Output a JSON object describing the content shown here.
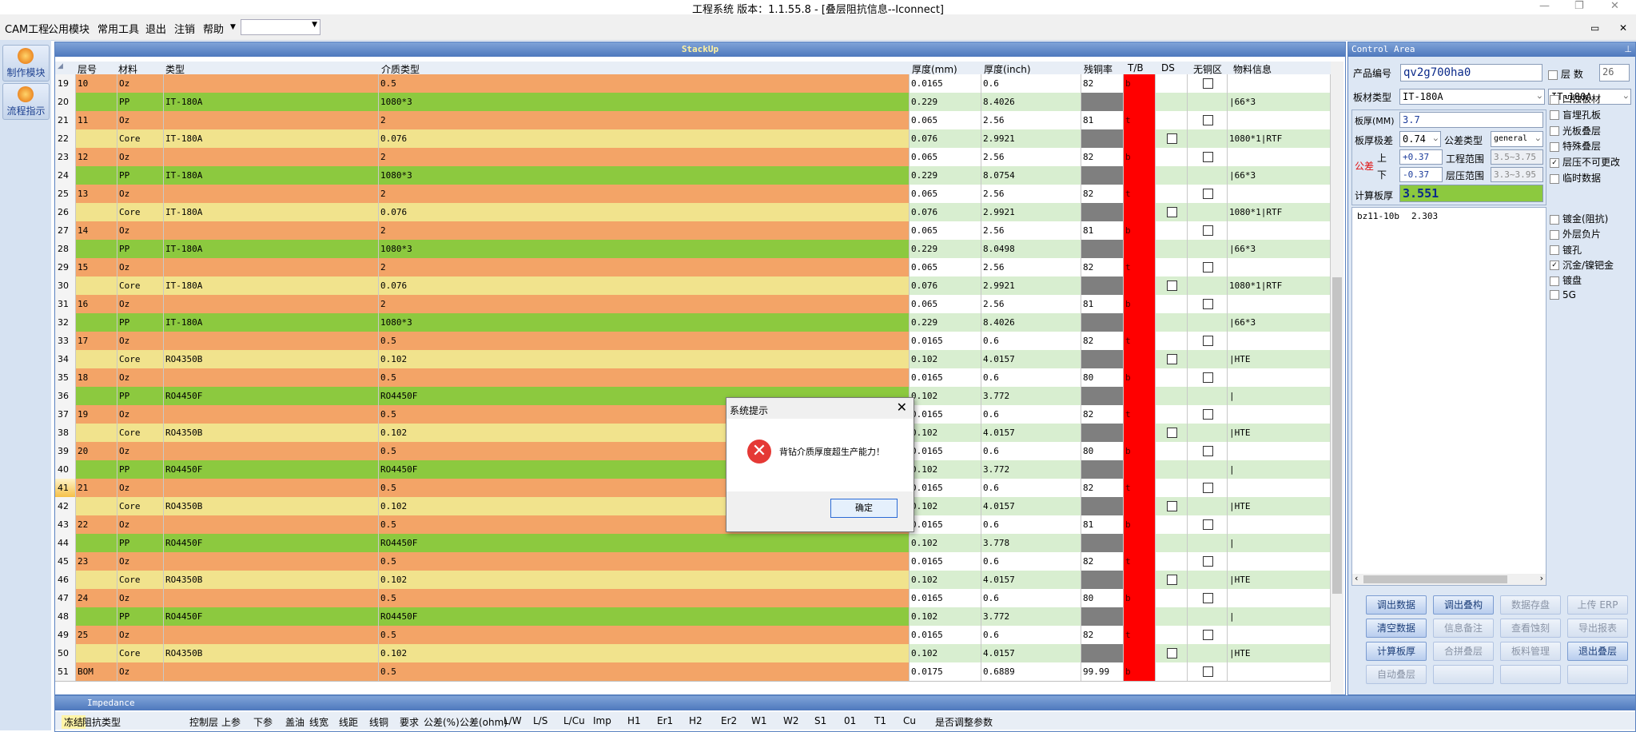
{
  "window": {
    "title": "工程系统   版本：1.1.55.8 - [叠层阻抗信息--Iconnect]"
  },
  "menu": {
    "items": [
      "CAM工程",
      "公用模块",
      "常用工具",
      "退出",
      "注销",
      "帮助"
    ]
  },
  "left_nav": [
    {
      "label": "制作模块",
      "icon": "flame-icon"
    },
    {
      "label": "流程指示",
      "icon": "pause-icon"
    }
  ],
  "stackup": {
    "title": "StackUp",
    "columns": [
      "层号",
      "材料",
      "类型",
      "介质类型",
      "厚度(mm)",
      "厚度(inch)",
      "残铜率",
      "T/B",
      "DS",
      "无铜区",
      "物料信息"
    ],
    "rows": [
      {
        "n": "19",
        "layer": "10",
        "mat": "Oz",
        "type": "",
        "med": "0.5",
        "mm": "0.0165",
        "inch": "0.6",
        "cu": "82",
        "tb": "b",
        "ds": false,
        "nocu": true,
        "info": ""
      },
      {
        "n": "20",
        "layer": "",
        "mat": "PP",
        "type": "IT-180A",
        "med": "1080*3",
        "mm": "0.229",
        "inch": "8.4026",
        "cu": "",
        "tb": "",
        "ds": false,
        "nocu": false,
        "info": "|66*3"
      },
      {
        "n": "21",
        "layer": "11",
        "mat": "Oz",
        "type": "",
        "med": "2",
        "mm": "0.065",
        "inch": "2.56",
        "cu": "81",
        "tb": "t",
        "ds": false,
        "nocu": true,
        "info": ""
      },
      {
        "n": "22",
        "layer": "",
        "mat": "Core",
        "type": "IT-180A",
        "med": "0.076",
        "mm": "0.076",
        "inch": "2.9921",
        "cu": "",
        "tb": "",
        "ds": true,
        "nocu": false,
        "info": "1080*1|RTF"
      },
      {
        "n": "23",
        "layer": "12",
        "mat": "Oz",
        "type": "",
        "med": "2",
        "mm": "0.065",
        "inch": "2.56",
        "cu": "82",
        "tb": "b",
        "ds": false,
        "nocu": true,
        "info": ""
      },
      {
        "n": "24",
        "layer": "",
        "mat": "PP",
        "type": "IT-180A",
        "med": "1080*3",
        "mm": "0.229",
        "inch": "8.0754",
        "cu": "",
        "tb": "",
        "ds": false,
        "nocu": false,
        "info": "|66*3"
      },
      {
        "n": "25",
        "layer": "13",
        "mat": "Oz",
        "type": "",
        "med": "2",
        "mm": "0.065",
        "inch": "2.56",
        "cu": "82",
        "tb": "t",
        "ds": false,
        "nocu": true,
        "info": ""
      },
      {
        "n": "26",
        "layer": "",
        "mat": "Core",
        "type": "IT-180A",
        "med": "0.076",
        "mm": "0.076",
        "inch": "2.9921",
        "cu": "",
        "tb": "",
        "ds": true,
        "nocu": false,
        "info": "1080*1|RTF"
      },
      {
        "n": "27",
        "layer": "14",
        "mat": "Oz",
        "type": "",
        "med": "2",
        "mm": "0.065",
        "inch": "2.56",
        "cu": "81",
        "tb": "b",
        "ds": false,
        "nocu": true,
        "info": ""
      },
      {
        "n": "28",
        "layer": "",
        "mat": "PP",
        "type": "IT-180A",
        "med": "1080*3",
        "mm": "0.229",
        "inch": "8.0498",
        "cu": "",
        "tb": "",
        "ds": false,
        "nocu": false,
        "info": "|66*3"
      },
      {
        "n": "29",
        "layer": "15",
        "mat": "Oz",
        "type": "",
        "med": "2",
        "mm": "0.065",
        "inch": "2.56",
        "cu": "82",
        "tb": "t",
        "ds": false,
        "nocu": true,
        "info": ""
      },
      {
        "n": "30",
        "layer": "",
        "mat": "Core",
        "type": "IT-180A",
        "med": "0.076",
        "mm": "0.076",
        "inch": "2.9921",
        "cu": "",
        "tb": "",
        "ds": true,
        "nocu": false,
        "info": "1080*1|RTF"
      },
      {
        "n": "31",
        "layer": "16",
        "mat": "Oz",
        "type": "",
        "med": "2",
        "mm": "0.065",
        "inch": "2.56",
        "cu": "81",
        "tb": "b",
        "ds": false,
        "nocu": true,
        "info": ""
      },
      {
        "n": "32",
        "layer": "",
        "mat": "PP",
        "type": "IT-180A",
        "med": "1080*3",
        "mm": "0.229",
        "inch": "8.4026",
        "cu": "",
        "tb": "",
        "ds": false,
        "nocu": false,
        "info": "|66*3"
      },
      {
        "n": "33",
        "layer": "17",
        "mat": "Oz",
        "type": "",
        "med": "0.5",
        "mm": "0.0165",
        "inch": "0.6",
        "cu": "82",
        "tb": "t",
        "ds": false,
        "nocu": true,
        "info": ""
      },
      {
        "n": "34",
        "layer": "",
        "mat": "Core",
        "type": "RO4350B",
        "med": "0.102",
        "mm": "0.102",
        "inch": "4.0157",
        "cu": "",
        "tb": "",
        "ds": true,
        "nocu": false,
        "info": "|HTE"
      },
      {
        "n": "35",
        "layer": "18",
        "mat": "Oz",
        "type": "",
        "med": "0.5",
        "mm": "0.0165",
        "inch": "0.6",
        "cu": "80",
        "tb": "b",
        "ds": false,
        "nocu": true,
        "info": ""
      },
      {
        "n": "36",
        "layer": "",
        "mat": "PP",
        "type": "RO4450F",
        "med": "RO4450F",
        "mm": "0.102",
        "inch": "3.772",
        "cu": "",
        "tb": "",
        "ds": false,
        "nocu": false,
        "info": "|"
      },
      {
        "n": "37",
        "layer": "19",
        "mat": "Oz",
        "type": "",
        "med": "0.5",
        "mm": "0.0165",
        "inch": "0.6",
        "cu": "82",
        "tb": "t",
        "ds": false,
        "nocu": true,
        "info": ""
      },
      {
        "n": "38",
        "layer": "",
        "mat": "Core",
        "type": "RO4350B",
        "med": "0.102",
        "mm": "0.102",
        "inch": "4.0157",
        "cu": "",
        "tb": "",
        "ds": true,
        "nocu": false,
        "info": "|HTE"
      },
      {
        "n": "39",
        "layer": "20",
        "mat": "Oz",
        "type": "",
        "med": "0.5",
        "mm": "0.0165",
        "inch": "0.6",
        "cu": "80",
        "tb": "b",
        "ds": false,
        "nocu": true,
        "info": ""
      },
      {
        "n": "40",
        "layer": "",
        "mat": "PP",
        "type": "RO4450F",
        "med": "RO4450F",
        "mm": "0.102",
        "inch": "3.772",
        "cu": "",
        "tb": "",
        "ds": false,
        "nocu": false,
        "info": "|"
      },
      {
        "n": "41",
        "layer": "21",
        "mat": "Oz",
        "type": "",
        "med": "0.5",
        "mm": "0.0165",
        "inch": "0.6",
        "cu": "82",
        "tb": "t",
        "ds": false,
        "nocu": true,
        "info": ""
      },
      {
        "n": "42",
        "layer": "",
        "mat": "Core",
        "type": "RO4350B",
        "med": "0.102",
        "mm": "0.102",
        "inch": "4.0157",
        "cu": "",
        "tb": "",
        "ds": true,
        "nocu": false,
        "info": "|HTE"
      },
      {
        "n": "43",
        "layer": "22",
        "mat": "Oz",
        "type": "",
        "med": "0.5",
        "mm": "0.0165",
        "inch": "0.6",
        "cu": "81",
        "tb": "b",
        "ds": false,
        "nocu": true,
        "info": ""
      },
      {
        "n": "44",
        "layer": "",
        "mat": "PP",
        "type": "RO4450F",
        "med": "RO4450F",
        "mm": "0.102",
        "inch": "3.778",
        "cu": "",
        "tb": "",
        "ds": false,
        "nocu": false,
        "info": "|"
      },
      {
        "n": "45",
        "layer": "23",
        "mat": "Oz",
        "type": "",
        "med": "0.5",
        "mm": "0.0165",
        "inch": "0.6",
        "cu": "82",
        "tb": "t",
        "ds": false,
        "nocu": true,
        "info": ""
      },
      {
        "n": "46",
        "layer": "",
        "mat": "Core",
        "type": "RO4350B",
        "med": "0.102",
        "mm": "0.102",
        "inch": "4.0157",
        "cu": "",
        "tb": "",
        "ds": true,
        "nocu": false,
        "info": "|HTE"
      },
      {
        "n": "47",
        "layer": "24",
        "mat": "Oz",
        "type": "",
        "med": "0.5",
        "mm": "0.0165",
        "inch": "0.6",
        "cu": "80",
        "tb": "b",
        "ds": false,
        "nocu": true,
        "info": ""
      },
      {
        "n": "48",
        "layer": "",
        "mat": "PP",
        "type": "RO4450F",
        "med": "RO4450F",
        "mm": "0.102",
        "inch": "3.772",
        "cu": "",
        "tb": "",
        "ds": false,
        "nocu": false,
        "info": "|"
      },
      {
        "n": "49",
        "layer": "25",
        "mat": "Oz",
        "type": "",
        "med": "0.5",
        "mm": "0.0165",
        "inch": "0.6",
        "cu": "82",
        "tb": "t",
        "ds": false,
        "nocu": true,
        "info": ""
      },
      {
        "n": "50",
        "layer": "",
        "mat": "Core",
        "type": "RO4350B",
        "med": "0.102",
        "mm": "0.102",
        "inch": "4.0157",
        "cu": "",
        "tb": "",
        "ds": true,
        "nocu": false,
        "info": "|HTE"
      },
      {
        "n": "51",
        "layer": "BOM",
        "mat": "Oz",
        "type": "",
        "med": "0.5",
        "mm": "0.0175",
        "inch": "0.6889",
        "cu": "99.99",
        "tb": "b",
        "ds": false,
        "nocu": true,
        "info": ""
      }
    ]
  },
  "control": {
    "title": "Control Area",
    "product_label": "产品编号",
    "product_value": "qv2g700ha0",
    "layers_label": "层  数",
    "layers_value": "26",
    "board_type_label": "板材类型",
    "board_type_value": "IT-180A",
    "board_type_value2": "IT-180A",
    "thickness_label": "板厚(MM)",
    "thickness_value": "3.7",
    "tol_level_label": "板厚极差",
    "tol_level_value": "0.74",
    "tol_type_label": "公差类型",
    "tol_type_value": "general",
    "tol_label": "公差",
    "upper_label": "上",
    "lower_label": "下",
    "upper_value": "+0.37",
    "lower_value": "-0.37",
    "eng_range_label": "工程范围",
    "eng_range_value": "3.5~3.75",
    "press_range_label": "层压范围",
    "press_range_value": "3.3~3.95",
    "calc_label": "计算板厚",
    "calc_value": "3.551",
    "list_item": {
      "name": "bz11-10b",
      "value": "2.303"
    },
    "checks": [
      {
        "label": "凹蚀板材",
        "checked": false
      },
      {
        "label": "盲埋孔板",
        "checked": false
      },
      {
        "label": "光板叠层",
        "checked": false
      },
      {
        "label": "特殊叠层",
        "checked": false
      },
      {
        "label": "层压不可更改",
        "checked": true
      },
      {
        "label": "临时数据",
        "checked": false
      },
      {
        "label": "镀金(阻抗)",
        "checked": false
      },
      {
        "label": "外层负片",
        "checked": false
      },
      {
        "label": "镀孔",
        "checked": false
      },
      {
        "label": "沉金/镍钯金",
        "checked": true
      },
      {
        "label": "镀盘",
        "checked": false
      },
      {
        "label": "5G",
        "checked": false
      }
    ],
    "buttons": [
      {
        "label": "调出数据",
        "enabled": true
      },
      {
        "label": "调出叠构",
        "enabled": true
      },
      {
        "label": "数据存盘",
        "enabled": false
      },
      {
        "label": "上传 ERP",
        "enabled": false
      },
      {
        "label": "清空数据",
        "enabled": true
      },
      {
        "label": "信息备注",
        "enabled": false
      },
      {
        "label": "查看蚀刻",
        "enabled": false
      },
      {
        "label": "导出报表",
        "enabled": false
      },
      {
        "label": "计算板厚",
        "enabled": true
      },
      {
        "label": "合拼叠层",
        "enabled": false
      },
      {
        "label": "板料管理",
        "enabled": false
      },
      {
        "label": "退出叠层",
        "enabled": true
      },
      {
        "label": "自动叠层",
        "enabled": false
      },
      {
        "label": "",
        "enabled": false
      },
      {
        "label": "",
        "enabled": false
      },
      {
        "label": "",
        "enabled": false
      }
    ]
  },
  "impedance": {
    "title": "Impedance",
    "columns": [
      "冻结",
      "阻抗类型",
      "控制层",
      "上参",
      "下参",
      "盖油",
      "线宽",
      "线距",
      "线铜",
      "要求",
      "公差(%)",
      "公差(ohm)",
      "L/W",
      "L/S",
      "L/Cu",
      "Imp",
      "H1",
      "Er1",
      "H2",
      "Er2",
      "W1",
      "W2",
      "S1",
      "01",
      "T1",
      "Cu",
      "是否调整参数"
    ]
  },
  "dialog": {
    "title": "系统提示",
    "message": "背钻介质厚度超生产能力！",
    "ok": "确定"
  },
  "colors": {
    "oz": "#f3a467",
    "pp": "#8cc93f",
    "core": "#f1e38d",
    "tb_red": "#ff0000",
    "cu_gray": "#7f7f7f",
    "accent": "#5a82c0"
  }
}
